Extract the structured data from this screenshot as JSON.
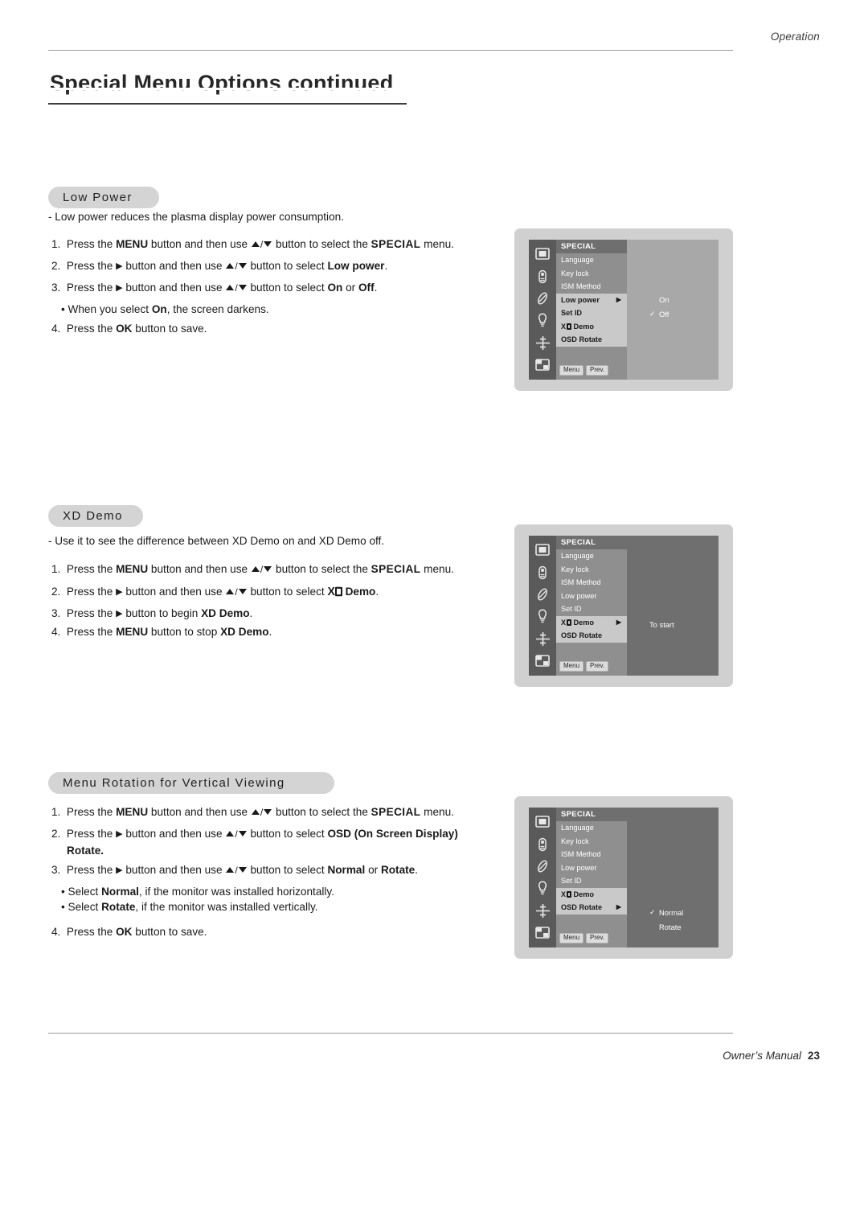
{
  "header": {
    "section_label": "Operation",
    "title": "Special Menu Options continued"
  },
  "footer": {
    "manual_label": "Owner’s Manual",
    "page_number": "23"
  },
  "sections": [
    {
      "pill_label": "Low Power",
      "intro": "-    Low power reduces the plasma display power consumption.",
      "steps": [
        "1.  Press the MENU button and then use ▲ / ▼ button to select the SPECIAL menu.",
        "2.  Press the ▶ button and then use ▲ / ▼ button to select Low power.",
        "3.  Press the ▶ button and then use ▲ / ▼ button to select On or Off.",
        "• When you select On, the screen darkens.",
        "4.  Press the OK button to save."
      ]
    },
    {
      "pill_label": "XD Demo",
      "intro": "-    Use it to see the difference between XD Demo on and XD Demo off.",
      "steps": [
        "1.  Press the MENU button and then use ▲ / ▼ button to select the SPECIAL menu.",
        "2.  Press the ▶ button and then use ▲ / ▼ button to select XD Demo.",
        "3.  Press the ▶ button to begin XD Demo.",
        "4.  Press the MENU button to stop XD Demo."
      ]
    },
    {
      "pill_label": "Menu Rotation for Vertical Viewing",
      "steps": [
        "1.  Press the MENU button and then use ▲ / ▼ button to select the SPECIAL menu.",
        "2.  Press the ▶ button and then use ▲ / ▼ button to select OSD (On Screen Display) Rotate.",
        "3.  Press the ▶ button and then use ▲ / ▼ button to select Normal or Rotate.",
        "• Select Normal, if the monitor was installed horizontally.",
        "• Select Rotate, if the monitor was installed vertically.",
        "4.  Press the OK button to save."
      ]
    }
  ],
  "text": {
    "press_the": "Press the",
    "button_and_then_use": "button and then use",
    "button_to_select_the": "button to select the",
    "button_to_select": "button to select",
    "menu_word": "menu.",
    "menu_btn": "MENU",
    "special_word": "SPECIAL",
    "low_power_val": "Low power",
    "on_word": "On",
    "or_word": "or",
    "off_word": "Off",
    "period": ".",
    "when_you_select": "• When you select",
    "screen_darkens": ", the screen darkens.",
    "press_ok_save_num": "4.",
    "press_ok_save": "button to save.",
    "ok_btn": "OK",
    "xd_intro": "-    Use it to see the difference between XD Demo on and XD Demo off.",
    "low_power_intro": "-    Low power reduces the plasma display power consumption.",
    "demo_word": "Demo",
    "button_to_begin": "button to begin",
    "xd_demo_bold": "XD Demo",
    "button_to_stop": "button to stop",
    "osd_word": "OSD",
    "on_screen_display": "(On Screen Display)",
    "rotate_word": "Rotate",
    "normal_word": "Normal",
    "select_normal_line": "• Select Normal, if the monitor was installed horizontally.",
    "select_rotate_line": "• Select Rotate, if the monitor was installed vertically.",
    "select_bullet": "• Select",
    "normal_tail": ", if the monitor was installed horizontally.",
    "rotate_tail": ", if the monitor was installed vertically.",
    "num1": "1.",
    "num2": "2.",
    "num3": "3.",
    "num4": "4."
  },
  "osd": {
    "title": "SPECIAL",
    "menu_items": [
      "Language",
      "Key lock",
      "ISM Method",
      "Low power",
      "Set ID",
      "XD Demo",
      "OSD Rotate"
    ],
    "buttons": {
      "menu": "Menu",
      "prev": "Prev."
    },
    "icon_names": [
      "picture-icon",
      "sound-icon",
      "timer-icon",
      "special-icon",
      "screen-icon",
      "pip-icon"
    ],
    "panel1": {
      "selected_item": "Low power",
      "options": [
        {
          "label": "On",
          "checked": false
        },
        {
          "label": "Off",
          "checked": true
        }
      ]
    },
    "panel2": {
      "selected_item": "XD Demo",
      "options": [
        {
          "label": "To start",
          "checked": false
        }
      ]
    },
    "panel3": {
      "selected_item": "OSD Rotate",
      "options": [
        {
          "label": "Normal",
          "checked": true
        },
        {
          "label": "Rotate",
          "checked": false
        }
      ]
    }
  },
  "colors": {
    "pill_bg": "#d4d4d4",
    "osd_bg": "#d0d0d0",
    "osd_menu_bg": "#8f8f8f",
    "osd_icon_bg": "#5a5a5a",
    "osd_selected": "#c9c9c9",
    "osd_right": "#a8a8a8",
    "osd_right_dark": "#6f6f6f"
  }
}
